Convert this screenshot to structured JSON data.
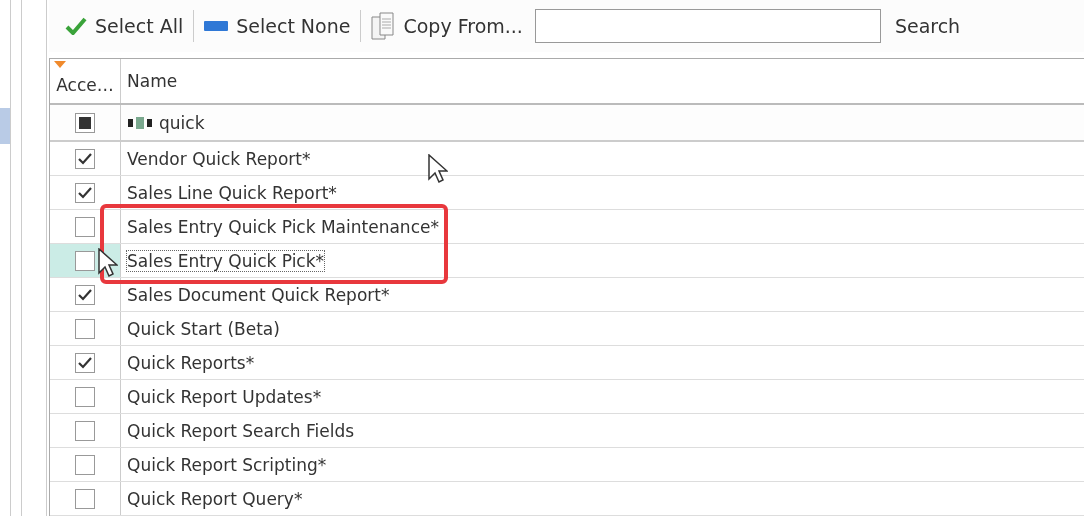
{
  "toolbar": {
    "buttons": [
      {
        "label": "Select All",
        "kind": "check"
      },
      {
        "label": "Select None",
        "kind": "none"
      },
      {
        "label": "Copy From...",
        "kind": "copy"
      }
    ],
    "search": {
      "label": "Search"
    }
  },
  "grid": {
    "columns": [
      "Acce…",
      "Name"
    ],
    "filter_row": {
      "indeterminate": true,
      "value": "quick"
    },
    "rows": [
      {
        "name": "Vendor Quick Report*",
        "checked": true,
        "selected": false,
        "highlighted": false
      },
      {
        "name": "Sales Line Quick Report*",
        "checked": true,
        "selected": false,
        "highlighted": false
      },
      {
        "name": "Sales Entry Quick Pick Maintenance*",
        "checked": false,
        "selected": false,
        "highlighted": true
      },
      {
        "name": "Sales Entry Quick Pick*",
        "checked": false,
        "selected": true,
        "highlighted": true
      },
      {
        "name": "Sales Document Quick Report*",
        "checked": true,
        "selected": false,
        "highlighted": false
      },
      {
        "name": "Quick Start (Beta)",
        "checked": false,
        "selected": false,
        "highlighted": false
      },
      {
        "name": "Quick Reports*",
        "checked": true,
        "selected": false,
        "highlighted": false
      },
      {
        "name": "Quick Report Updates*",
        "checked": false,
        "selected": false,
        "highlighted": false
      },
      {
        "name": "Quick Report Search Fields",
        "checked": false,
        "selected": false,
        "highlighted": false
      },
      {
        "name": "Quick Report Scripting*",
        "checked": false,
        "selected": false,
        "highlighted": false
      },
      {
        "name": "Quick Report Query*",
        "checked": false,
        "selected": false,
        "highlighted": false
      }
    ]
  }
}
